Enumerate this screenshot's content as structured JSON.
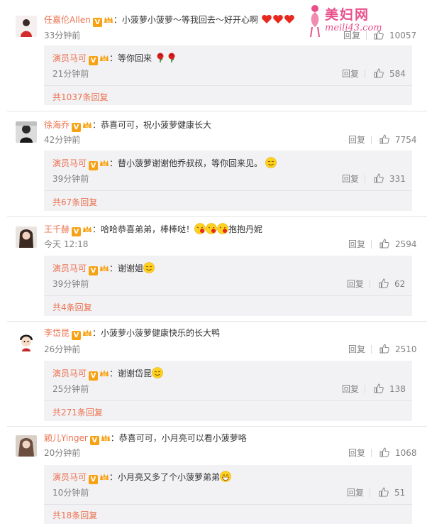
{
  "watermark": {
    "title": "美妇网",
    "url": "meili43.com"
  },
  "colors": {
    "name": "#eb7350",
    "meta": "#808080",
    "sub_bg": "#f2f2f5",
    "vip": "#f7a214"
  },
  "comments": [
    {
      "author": "任嘉伦Allen",
      "text": "：小菠萝小菠萝～等我回去～好开心啊",
      "time": "33分钟前",
      "reply": "回复",
      "likes": "10057",
      "emoji": [
        "heart-icon",
        "heart-icon",
        "heart-icon"
      ],
      "sub": {
        "author": "演员马可",
        "text": "：等你回来",
        "time": "21分钟前",
        "reply": "回复",
        "likes": "584",
        "emoji": [
          "rose-icon",
          "rose-icon"
        ]
      },
      "more": "共1037条回复"
    },
    {
      "author": "徐海乔",
      "text": "：恭喜可可，祝小菠萝健康长大",
      "time": "42分钟前",
      "reply": "回复",
      "likes": "7754",
      "sub": {
        "author": "演员马可",
        "text": "：替小菠萝谢谢他乔叔叔，等你回来见。",
        "time": "39分钟前",
        "reply": "回复",
        "likes": "331",
        "emoji": [
          "smile-icon"
        ]
      },
      "more": "共67条回复"
    },
    {
      "author": "王千赫",
      "text": "：哈哈恭喜弟弟，棒棒哒！",
      "text2": "抱抱丹妮",
      "time": "今天 12:18",
      "reply": "回复",
      "likes": "2594",
      "emoji": [
        "kiss-icon",
        "kiss-icon",
        "kiss-icon"
      ],
      "sub": {
        "author": "演员马可",
        "text": "：谢谢姐",
        "time": "39分钟前",
        "reply": "回复",
        "likes": "62",
        "emoji": [
          "smile-icon"
        ]
      },
      "more": "共4条回复"
    },
    {
      "author": "李岱昆",
      "text": "：小菠萝小菠萝健康快乐的长大鸭",
      "time": "26分钟前",
      "reply": "回复",
      "likes": "2510",
      "sub": {
        "author": "演员马可",
        "text": "：谢谢岱昆",
        "time": "25分钟前",
        "reply": "回复",
        "likes": "138",
        "emoji": [
          "smile-icon"
        ]
      },
      "more": "共271条回复"
    },
    {
      "author": "颖儿Yinger",
      "text": "：恭喜可可，小月亮可以看小菠萝咯",
      "time": "20分钟前",
      "reply": "回复",
      "likes": "1068",
      "sub": {
        "author": "演员马可",
        "text": "：小月亮又多了个小菠萝弟弟",
        "time": "10分钟前",
        "reply": "回复",
        "likes": "51",
        "emoji": [
          "grin-icon"
        ]
      },
      "more": "共18条回复"
    }
  ]
}
